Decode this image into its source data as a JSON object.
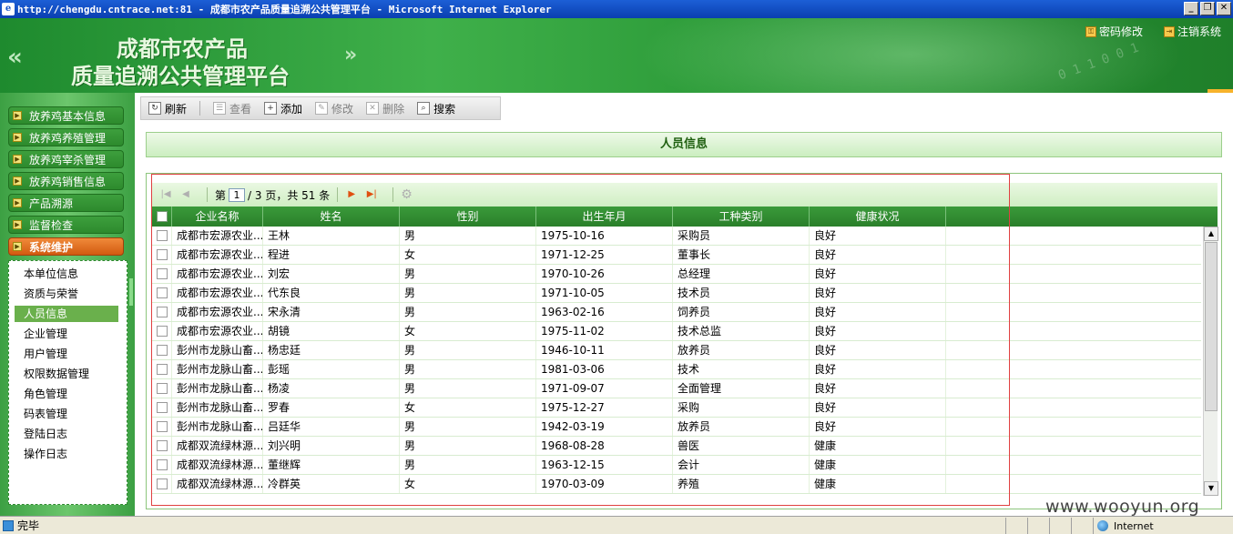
{
  "window": {
    "title": "http://chengdu.cntrace.net:81 - 成都市农产品质量追溯公共管理平台 - Microsoft Internet Explorer",
    "btn_minimize": "_",
    "btn_restore": "❐",
    "btn_close": "✕"
  },
  "banner": {
    "title_line1": "成都市农产品",
    "title_line2": "质量追溯公共管理平台",
    "link_password": "密码修改",
    "link_logout": "注销系统"
  },
  "sidebar": {
    "menu": [
      {
        "label": "放养鸡基本信息"
      },
      {
        "label": "放养鸡养殖管理"
      },
      {
        "label": "放养鸡宰杀管理"
      },
      {
        "label": "放养鸡销售信息"
      },
      {
        "label": "产品溯源"
      },
      {
        "label": "监督检查"
      },
      {
        "label": "系统维护"
      }
    ],
    "submenu": [
      {
        "label": "本单位信息"
      },
      {
        "label": "资质与荣誉"
      },
      {
        "label": "人员信息"
      },
      {
        "label": "企业管理"
      },
      {
        "label": "用户管理"
      },
      {
        "label": "权限数据管理"
      },
      {
        "label": "角色管理"
      },
      {
        "label": "码表管理"
      },
      {
        "label": "登陆日志"
      },
      {
        "label": "操作日志"
      }
    ]
  },
  "toolbar": {
    "refresh": "刷新",
    "view": "查看",
    "add": "添加",
    "edit": "修改",
    "delete": "删除",
    "search": "搜索"
  },
  "panel": {
    "title": "人员信息"
  },
  "pager": {
    "page_prefix": "第",
    "current_page": "1",
    "page_suffix": "/ 3 页，共 51 条"
  },
  "grid": {
    "columns": [
      "企业名称",
      "姓名",
      "性别",
      "出生年月",
      "工种类别",
      "健康状况"
    ],
    "rows": [
      [
        "成都市宏源农业...",
        "王林",
        "男",
        "1975-10-16",
        "采购员",
        "良好"
      ],
      [
        "成都市宏源农业...",
        "程进",
        "女",
        "1971-12-25",
        "董事长",
        "良好"
      ],
      [
        "成都市宏源农业...",
        "刘宏",
        "男",
        "1970-10-26",
        "总经理",
        "良好"
      ],
      [
        "成都市宏源农业...",
        "代东良",
        "男",
        "1971-10-05",
        "技术员",
        "良好"
      ],
      [
        "成都市宏源农业...",
        "宋永清",
        "男",
        "1963-02-16",
        "饲养员",
        "良好"
      ],
      [
        "成都市宏源农业...",
        "胡镜",
        "女",
        "1975-11-02",
        "技术总监",
        "良好"
      ],
      [
        "彭州市龙脉山畜...",
        "杨忠廷",
        "男",
        "1946-10-11",
        "放养员",
        "良好"
      ],
      [
        "彭州市龙脉山畜...",
        "彭瑶",
        "男",
        "1981-03-06",
        "技术",
        "良好"
      ],
      [
        "彭州市龙脉山畜...",
        "杨凌",
        "男",
        "1971-09-07",
        "全面管理",
        "良好"
      ],
      [
        "彭州市龙脉山畜...",
        "罗春",
        "女",
        "1975-12-27",
        "采购",
        "良好"
      ],
      [
        "彭州市龙脉山畜...",
        "吕廷华",
        "男",
        "1942-03-19",
        "放养员",
        "良好"
      ],
      [
        "成都双流绿林源...",
        "刘兴明",
        "男",
        "1968-08-28",
        "兽医",
        "健康"
      ],
      [
        "成都双流绿林源...",
        "董继辉",
        "男",
        "1963-12-15",
        "会计",
        "健康"
      ],
      [
        "成都双流绿林源...",
        "冷群英",
        "女",
        "1970-03-09",
        "养殖",
        "健康"
      ]
    ]
  },
  "watermark": "www.wooyun.org",
  "status": {
    "text": "完毕",
    "zone": "Internet"
  },
  "colors": {
    "primary_green": "#2d8a2d",
    "active_menu": "#e0701f",
    "highlight_box": "#e04040"
  }
}
